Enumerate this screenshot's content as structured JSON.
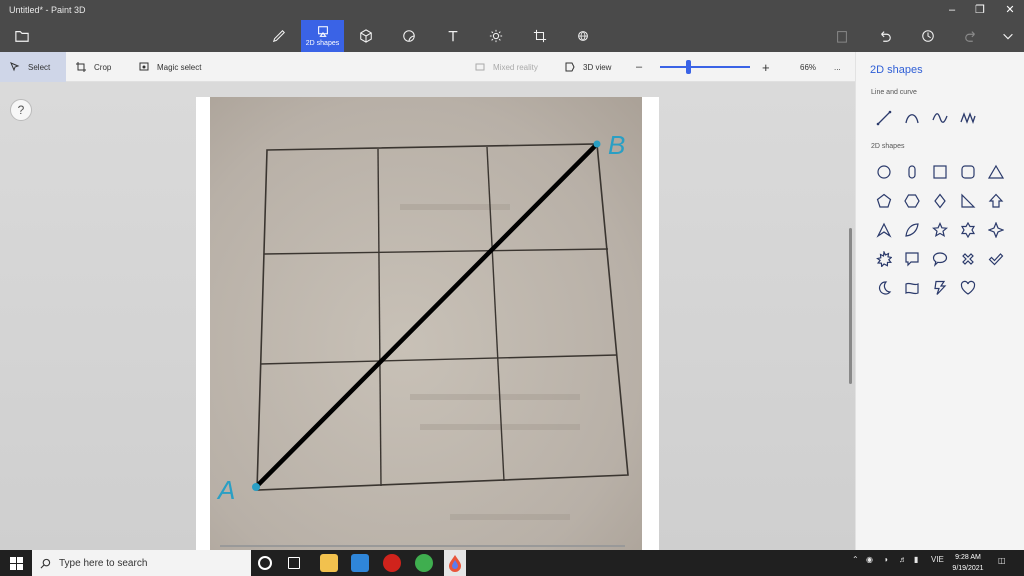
{
  "window": {
    "title": "Untitled* - Paint 3D"
  },
  "toolbar": {
    "active_tool_label": "2D shapes",
    "tools": [
      "brushes",
      "2D shapes",
      "3D shapes",
      "stickers",
      "text",
      "effects",
      "canvas",
      "3D library"
    ]
  },
  "subbar": {
    "select_label": "Select",
    "crop_label": "Crop",
    "magic_select_label": "Magic select",
    "mixed_reality_label": "Mixed reality",
    "view3d_label": "3D view",
    "zoom_level": "66%",
    "zoom_fraction": 0.32,
    "more_label": "..."
  },
  "help": {
    "label": "?"
  },
  "canvas_content": {
    "point_a": "A",
    "point_b": "B",
    "grid_rows": 3,
    "grid_cols": 3
  },
  "panel": {
    "title": "2D shapes",
    "line_section": "Line and curve",
    "shape_section": "2D shapes",
    "line_tools": [
      "line-icon",
      "curve-icon",
      "wave-icon",
      "polyline-icon"
    ],
    "shapes": [
      "circle",
      "capsule",
      "square",
      "rounded-square",
      "triangle",
      "pentagon",
      "hexagon",
      "diamond",
      "right-triangle",
      "arrow-up",
      "chevron-triangle",
      "leaf",
      "star5",
      "star6",
      "star4",
      "burst",
      "callout-rect",
      "callout-oval",
      "cross",
      "checkmark",
      "moon",
      "banner",
      "lightning",
      "heart"
    ]
  },
  "taskbar": {
    "search_placeholder": "Type here to search",
    "language": "VIE",
    "time": "9:28 AM",
    "date": "9/19/2021"
  },
  "colors": {
    "accent": "#3a63e6",
    "titlebar": "#4a4a4a",
    "panel_title": "#2f5fd6",
    "shape_icon": "#2b3a6b",
    "drawn_line": "#000000",
    "point_label": "#2a9fc4"
  }
}
